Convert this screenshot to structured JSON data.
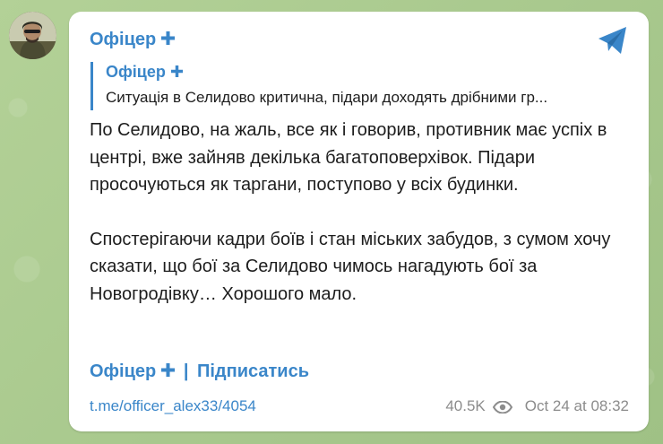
{
  "channel": {
    "name": "Офіцер",
    "plus_icon": "plus-icon",
    "accent": "#3a86c9"
  },
  "reply": {
    "title": "Офіцер",
    "text": "Ситуація в Селидово критична, підари доходять дрібними гр..."
  },
  "message": {
    "paragraph1": "По Селидово, на жаль, все як і говорив, противник має успіх в центрі, вже зайняв декілька багатоповерхівок. Підари просочуються як таргани, поступово у всіх будинки.",
    "paragraph2": "Спостерігаючи кадри боїв і стан міських забудов, з сумом хочу сказати, що бої за Селидово чимось нагадують бої за Новогродівку… Хорошого мало."
  },
  "footer": {
    "channel_link": "Офіцер",
    "separator": "|",
    "subscribe": "Підписатись",
    "post_url": "t.me/officer_alex33/4054",
    "views": "40.5K",
    "date": "Oct 24 at 08:32"
  },
  "icons": {
    "share": "telegram-share-icon",
    "views": "eye-icon"
  }
}
